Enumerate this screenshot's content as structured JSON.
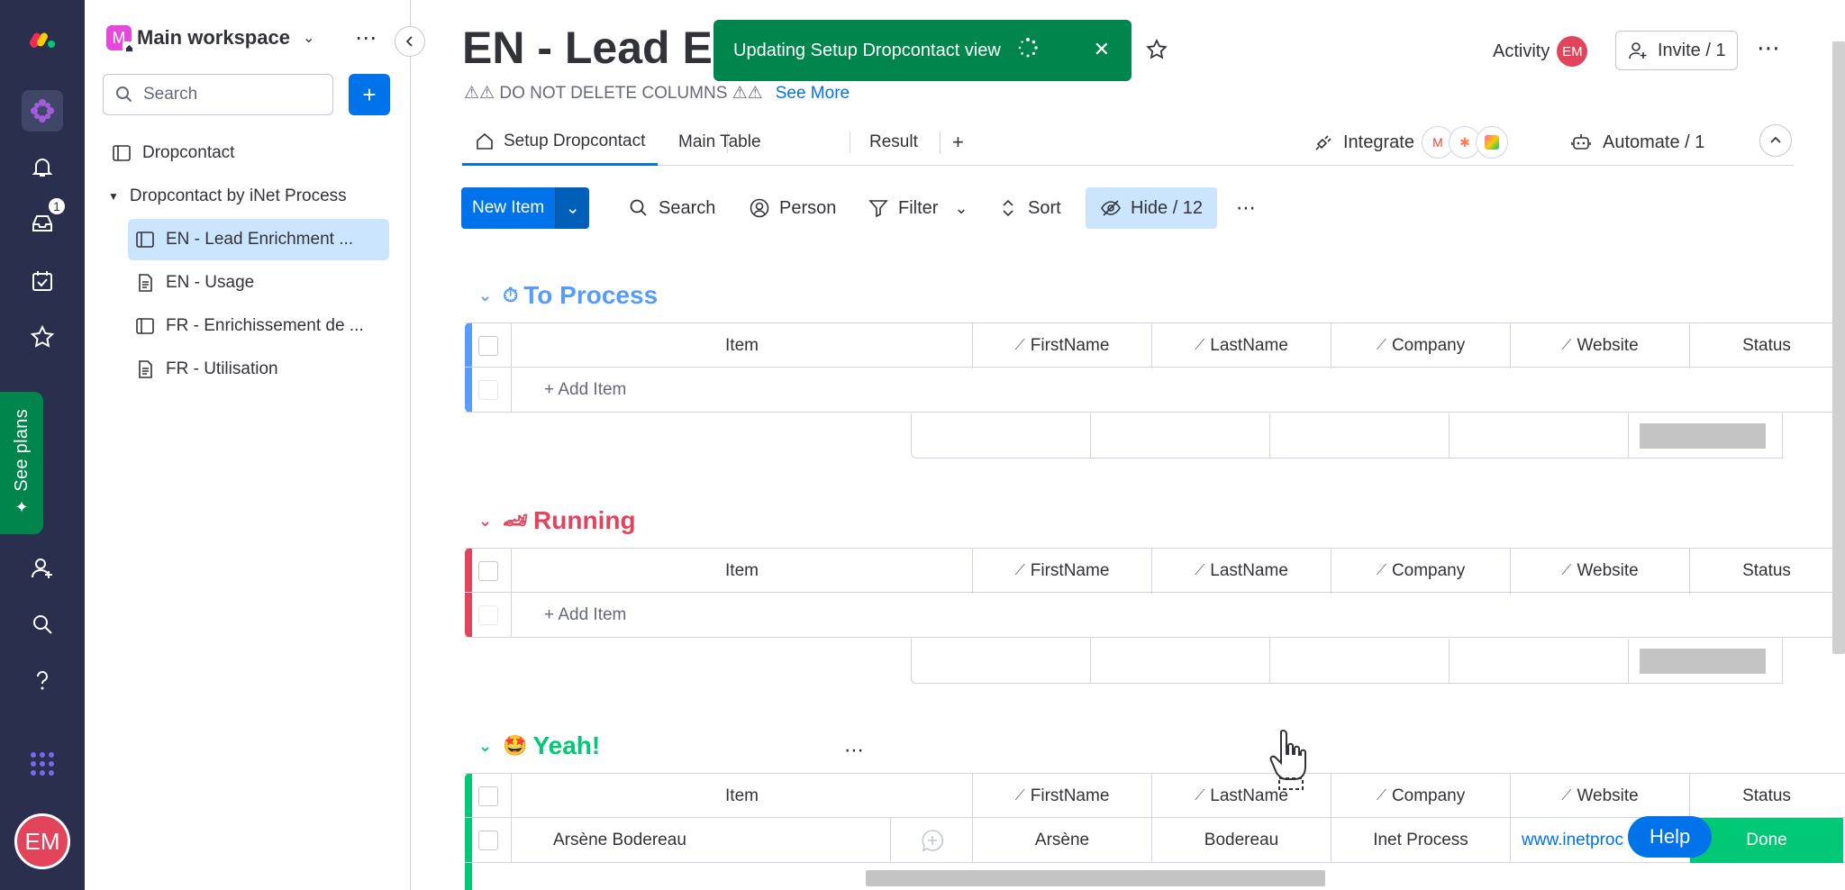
{
  "workspace": {
    "name": "Main workspace",
    "icon_letter": "M"
  },
  "rail": {
    "inbox_count": "1",
    "see_plans": "See plans",
    "avatar": "EM"
  },
  "sidebar": {
    "search_placeholder": "Search",
    "items": [
      {
        "label": "Dropcontact"
      },
      {
        "label": "Dropcontact by iNet Process"
      },
      {
        "label": "EN - Lead Enrichment ..."
      },
      {
        "label": "EN - Usage"
      },
      {
        "label": "FR - Enrichissement de ..."
      },
      {
        "label": "FR - Utilisation"
      }
    ]
  },
  "board": {
    "title": "EN - Lead En",
    "description": "⚠⚠ DO NOT DELETE COLUMNS ⚠⚠",
    "see_more": "See More"
  },
  "toast": {
    "message": "Updating Setup Dropcontact view"
  },
  "header": {
    "activity": "Activity",
    "activity_avatar": "EM",
    "invite": "Invite / 1"
  },
  "tabs": [
    {
      "label": "Setup Dropcontact"
    },
    {
      "label": "Main Table"
    },
    {
      "label": "Result"
    }
  ],
  "integrate": "Integrate",
  "automate": "Automate / 1",
  "toolbar": {
    "new_item": "New Item",
    "search": "Search",
    "person": "Person",
    "filter": "Filter",
    "sort": "Sort",
    "hide": "Hide / 12"
  },
  "columns": {
    "item": "Item",
    "firstname": "FirstName",
    "lastname": "LastName",
    "company": "Company",
    "website": "Website",
    "status": "Status"
  },
  "add_item": "+ Add Item",
  "groups": [
    {
      "title": "To Process",
      "emoji": "⏱",
      "color": "#579bfc"
    },
    {
      "title": "Running",
      "emoji": "🏎",
      "color": "#e2445c"
    },
    {
      "title": "Yeah!",
      "emoji": "🤩",
      "color": "#00c875"
    }
  ],
  "rows": [
    {
      "item": "Arsène Bodereau",
      "firstname": "Arsène",
      "lastname": "Bodereau",
      "company": "Inet Process",
      "website": "www.inetproc",
      "status": "Done"
    }
  ],
  "help": "Help"
}
